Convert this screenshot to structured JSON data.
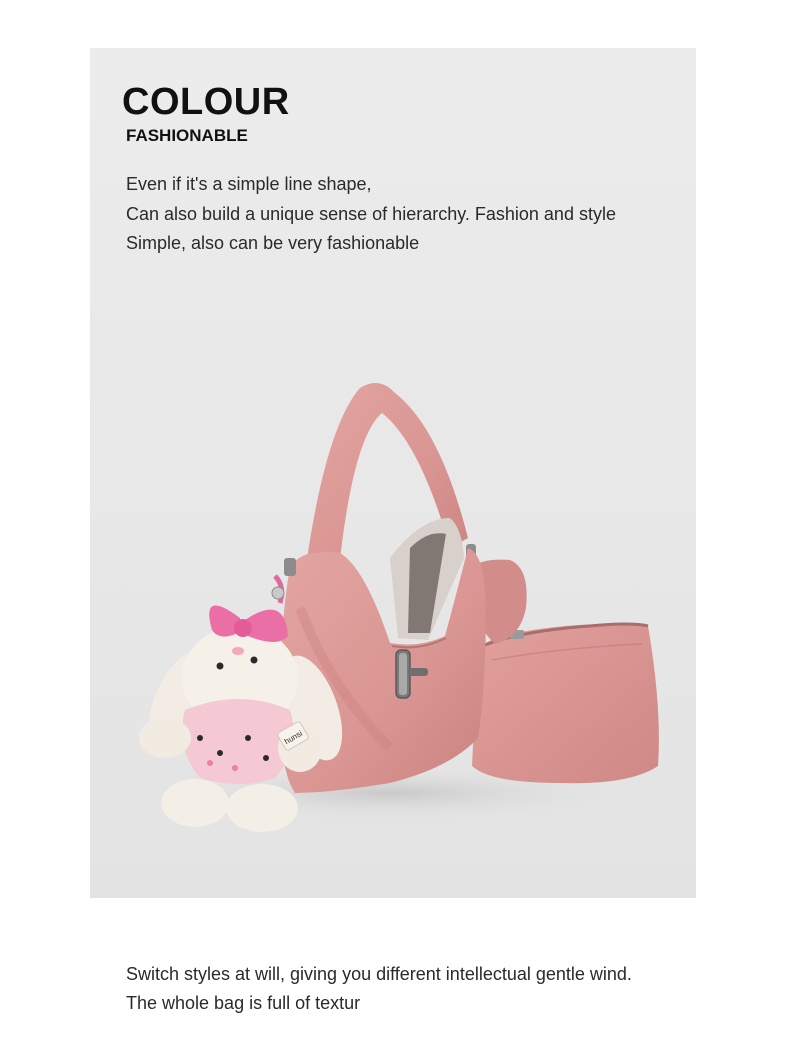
{
  "heading": "COLOUR",
  "subheading": "FASHIONABLE",
  "description": [
    "Even if it's a simple line shape,",
    "Can also build a unique sense of hierarchy. Fashion and style",
    "Simple, also can be very fashionable"
  ],
  "image": {
    "subject": "pink-suede-hobo-bag-with-pouch-and-bunny-charm",
    "charm_tag_text": "hunsi",
    "colors": {
      "bag": "#de9a98",
      "bag_shadow": "#c97f7e",
      "panel": "#e9e9e9",
      "bow": "#ea6fa6",
      "metal": "#8a8a8a"
    }
  },
  "footer": [
    "Switch styles at will, giving you different intellectual gentle wind.",
    "The whole bag is full of textur"
  ]
}
